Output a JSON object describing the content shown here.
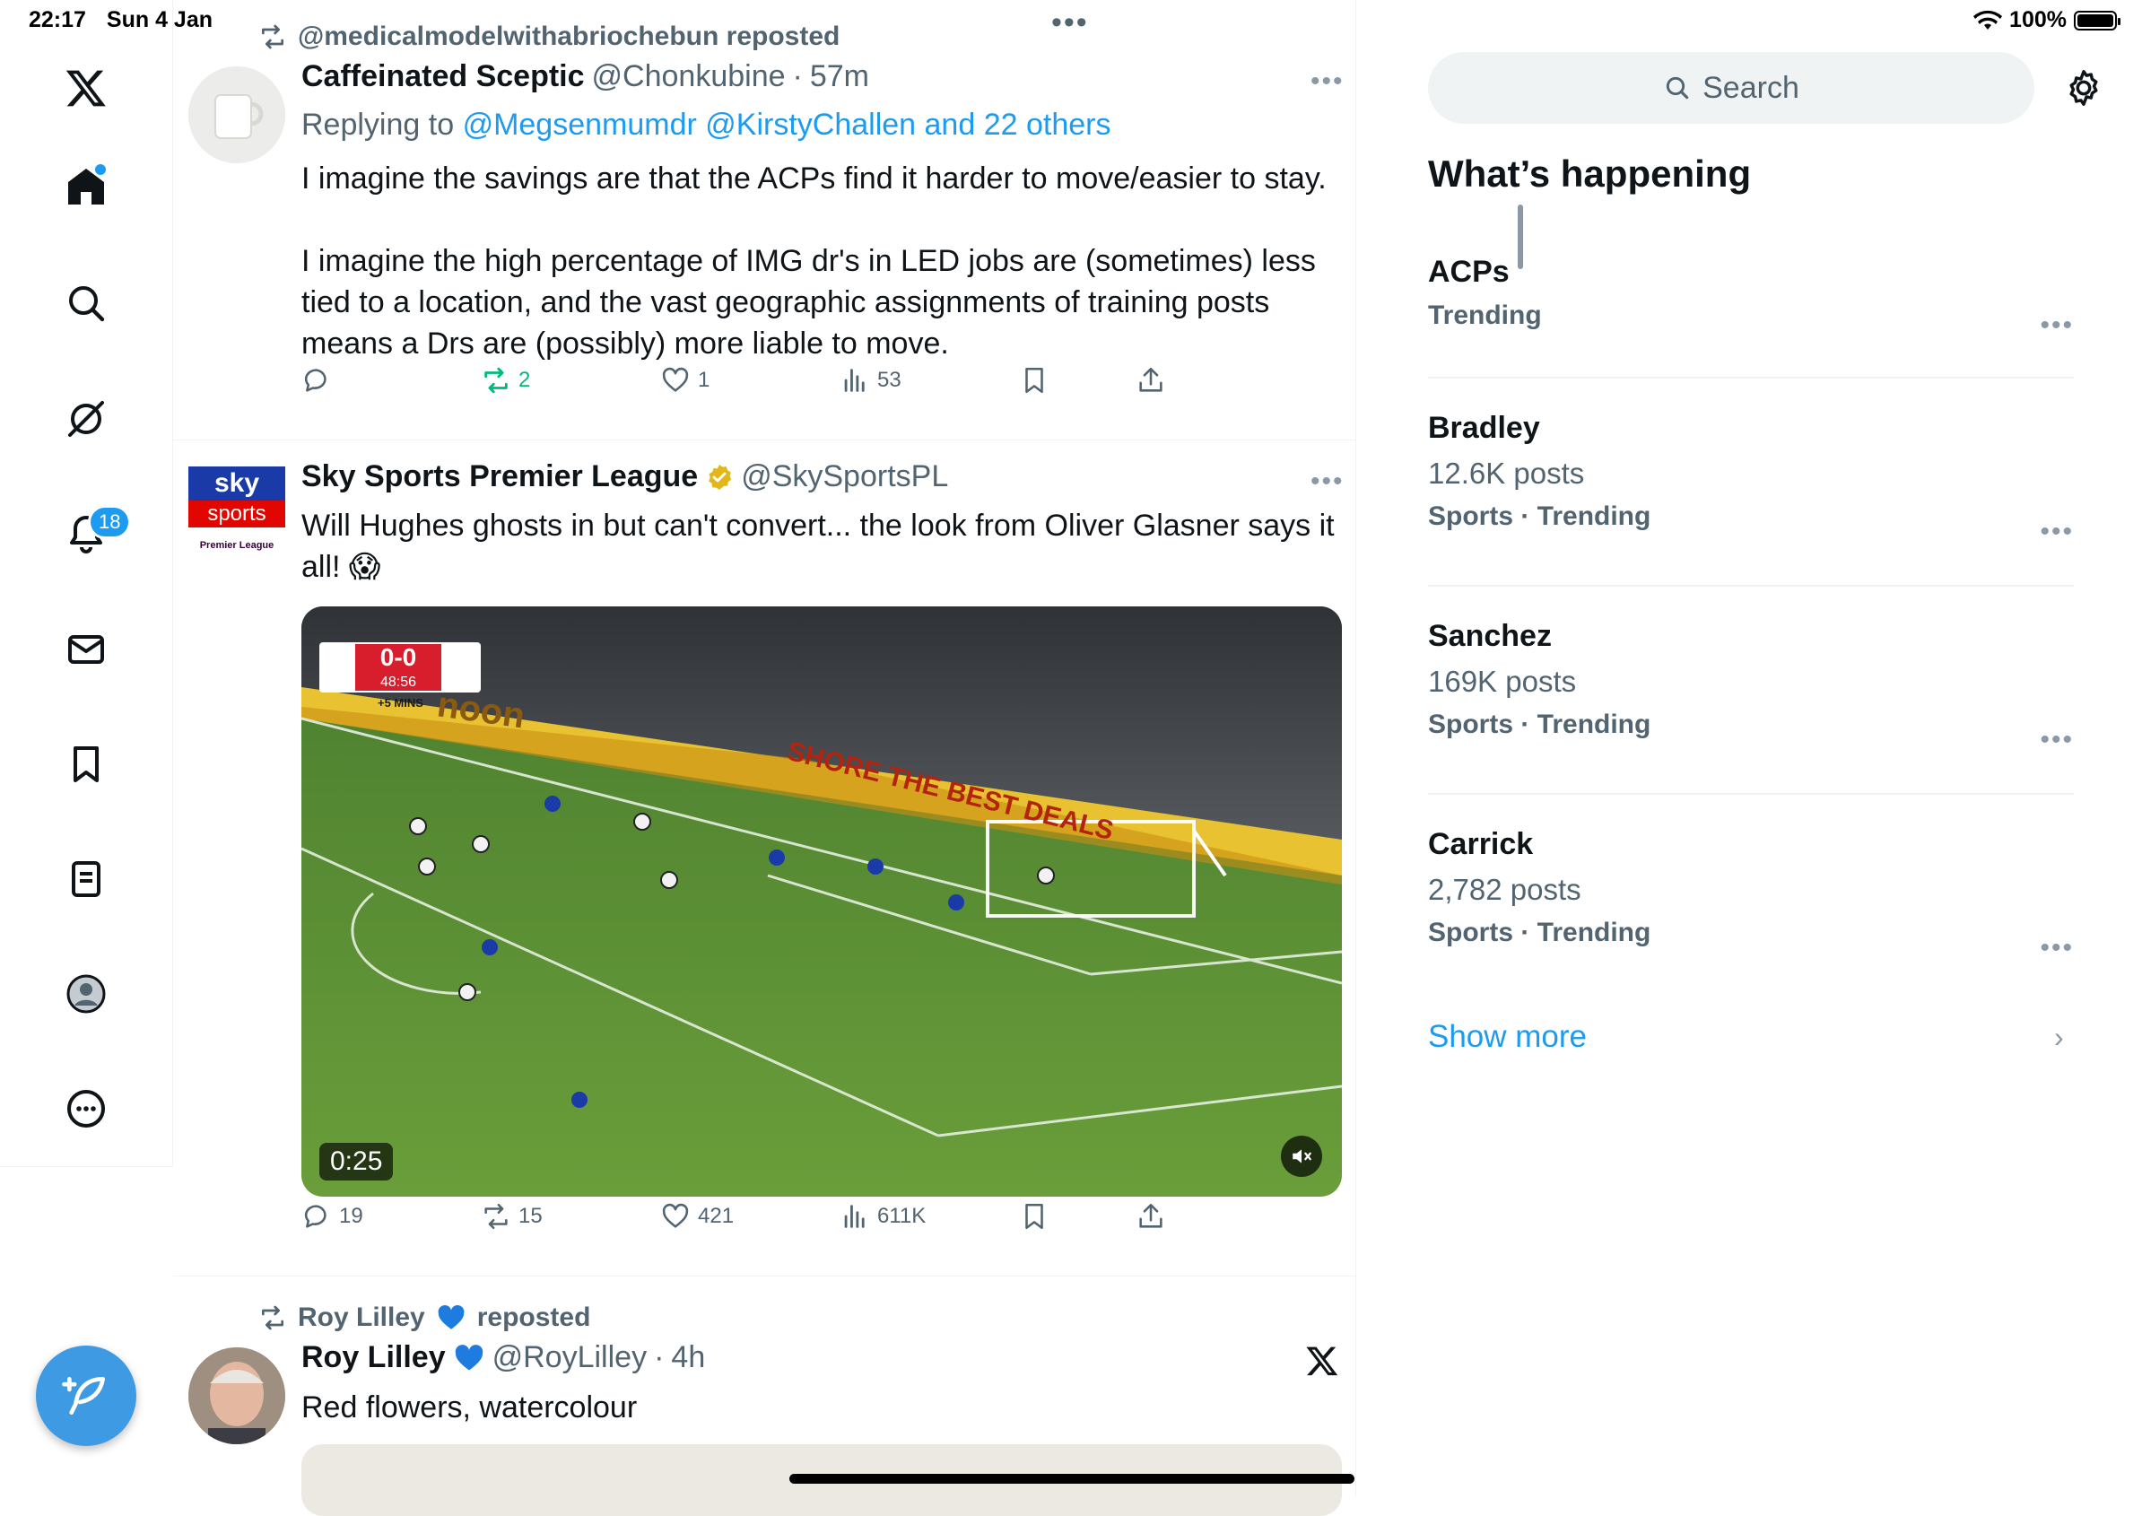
{
  "status": {
    "time": "22:17",
    "date": "Sun 4 Jan",
    "battery": "100%"
  },
  "nav": {
    "notifications_badge": "18",
    "items": [
      "x-logo-icon",
      "home-icon",
      "search-icon",
      "grok-icon",
      "notifications-icon",
      "messages-icon",
      "bookmarks-icon",
      "lists-icon",
      "profile-icon",
      "more-icon"
    ]
  },
  "tweets": [
    {
      "repost_label": "@medicalmodelwithabriochebun reposted",
      "name": "Caffeinated Sceptic",
      "handle": "@Chonkubine",
      "time": "57m",
      "replying_prefix": "Replying to",
      "replying_to": "@Megsenmumdr @KirstyChallen and 22 others",
      "text_p1": "I imagine the savings are that the ACPs find it harder to move/easier to stay.",
      "text_p2": "I imagine the high percentage of IMG dr's in LED jobs are (sometimes) less tied to a location, and the vast geographic assignments of training posts means a Drs are (possibly) more liable to move.",
      "replies": "",
      "reposts": "2",
      "likes": "1",
      "views": "53"
    },
    {
      "name": "Sky Sports Premier League",
      "handle": "@SkySportsPL",
      "text": "Will Hughes ghosts in but can't convert... the look from Oliver Glasner says it all! 😱",
      "avatar_top": "sky",
      "avatar_mid": "sports",
      "avatar_bot": "Premier League",
      "scoreboard": "0-0",
      "clock": "48:56",
      "added_time": "+5 MINS",
      "board_text1": "noon",
      "board_text2": "SHORE THE BEST DEALS",
      "video_duration": "0:25",
      "replies": "19",
      "reposts": "15",
      "likes": "421",
      "views": "611K"
    },
    {
      "repost_label_name": "Roy Lilley",
      "repost_label_suffix": "reposted",
      "name": "Roy Lilley",
      "handle": "@RoyLilley",
      "time": "4h",
      "text": "Red flowers, watercolour"
    }
  ],
  "sidebar": {
    "search_placeholder": "Search",
    "heading": "What’s happening",
    "trends": [
      {
        "title": "ACPs",
        "meta": "Trending"
      },
      {
        "title": "Bradley",
        "posts": "12.6K posts",
        "meta": "Sports · Trending"
      },
      {
        "title": "Sanchez",
        "posts": "169K posts",
        "meta": "Sports · Trending"
      },
      {
        "title": "Carrick",
        "posts": "2,782 posts",
        "meta": "Sports · Trending"
      }
    ],
    "show_more": "Show more"
  },
  "colors": {
    "accent": "#1d9bf0",
    "repost_green": "#00ba7c",
    "muted": "#536471"
  }
}
